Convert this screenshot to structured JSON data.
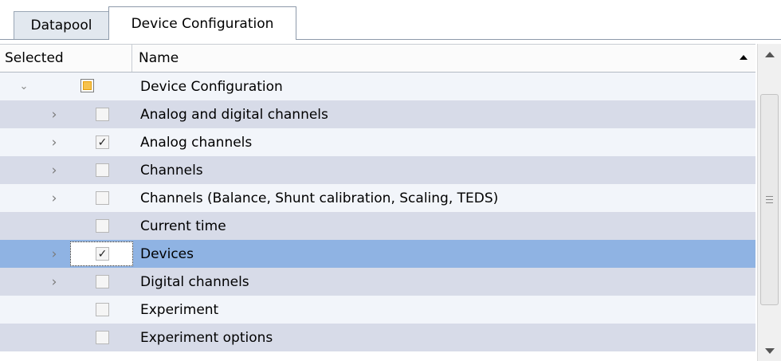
{
  "tabs": [
    {
      "label": "Datapool"
    },
    {
      "label": "Device Configuration"
    }
  ],
  "columns": {
    "selected": "Selected",
    "name": "Name"
  },
  "rows": [
    {
      "name": "Device Configuration",
      "expander": "collapse",
      "check": "partial"
    },
    {
      "name": "Analog and digital channels",
      "expander": "expand",
      "check": "unchecked"
    },
    {
      "name": "Analog channels",
      "expander": "expand",
      "check": "checked"
    },
    {
      "name": "Channels",
      "expander": "expand",
      "check": "unchecked"
    },
    {
      "name": "Channels (Balance, Shunt calibration, Scaling, TEDS)",
      "expander": "expand",
      "check": "unchecked"
    },
    {
      "name": "Current time",
      "expander": "none",
      "check": "unchecked"
    },
    {
      "name": "Devices",
      "expander": "expand",
      "check": "checked",
      "selected": true
    },
    {
      "name": "Digital channels",
      "expander": "expand",
      "check": "unchecked"
    },
    {
      "name": "Experiment",
      "expander": "none",
      "check": "unchecked"
    },
    {
      "name": "Experiment options",
      "expander": "none",
      "check": "unchecked"
    }
  ],
  "glyphs": {
    "expand": "›",
    "collapse": "⌄",
    "check": "✓"
  },
  "colors": {
    "row_light": "#f2f5fa",
    "row_dark": "#d7dbe8",
    "row_selected": "#8fb3e3",
    "partial_fill": "#f6c24e"
  }
}
